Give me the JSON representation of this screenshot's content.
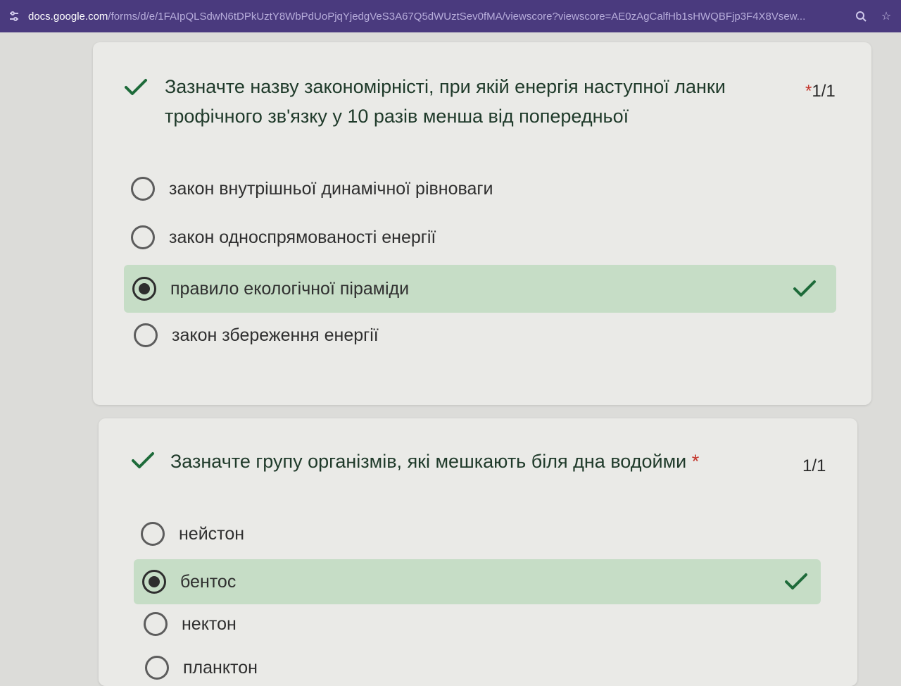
{
  "browser": {
    "url_host": "docs.google.com",
    "url_path": "/forms/d/e/1FAIpQLSdwN6tDPkUztY8WbPdUoPjqYjedgVeS3A67Q5dWUztSev0fMA/viewscore?viewscore=AE0zAgCalfHb1sHWQBFjp3F4X8Vsew..."
  },
  "questions": [
    {
      "title_line1": "Зазначте назву закономірністі, при якій енергія наступної ланки",
      "title_line2": "трофічного зв'язку у 10 разів менша від попередньої",
      "required_mark": "*",
      "score": "1/1",
      "options": [
        {
          "label": "закон внутрішньої динамічної рівноваги",
          "selected": false
        },
        {
          "label": "закон односпрямованості енергії",
          "selected": false
        },
        {
          "label": "правило екологічної піраміди",
          "selected": true,
          "correct": true
        },
        {
          "label": "закон збереження енергії",
          "selected": false
        }
      ]
    },
    {
      "title": "Зазначте групу організмів, які мешкають біля дна водойми",
      "required_mark": "*",
      "score": "1/1",
      "options": [
        {
          "label": "нейстон",
          "selected": false
        },
        {
          "label": "бентос",
          "selected": true,
          "correct": true
        },
        {
          "label": "нектон",
          "selected": false
        },
        {
          "label": "планктон",
          "selected": false
        }
      ]
    }
  ],
  "colors": {
    "address_bar": "#4a3a7e",
    "correct_highlight": "#c6ddc6",
    "check_green": "#1e6b3a",
    "required_star": "#c4362c"
  }
}
